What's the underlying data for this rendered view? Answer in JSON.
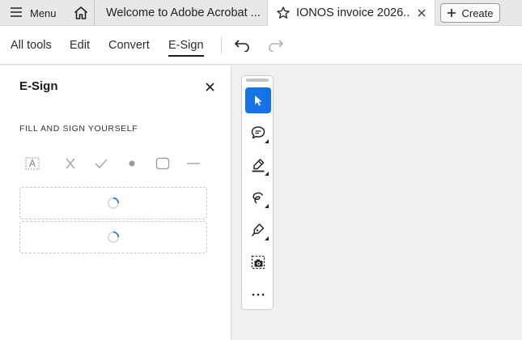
{
  "tabs": {
    "menu_label": "Menu",
    "welcome_title": "Welcome to Adobe Acrobat ...",
    "invoice_title": "IONOS invoice 2026...",
    "create_label": "Create"
  },
  "toolbar": {
    "items": [
      "All tools",
      "Edit",
      "Convert",
      "E-Sign"
    ],
    "active": "E-Sign"
  },
  "panel": {
    "title": "E-Sign",
    "section_label": "FILL AND SIGN YOURSELF",
    "sign_tools": [
      "text-field-icon",
      "cross-icon",
      "checkmark-icon",
      "dot-icon",
      "rounded-rect-icon",
      "line-icon"
    ]
  },
  "quick_actions": [
    "select-pointer-icon",
    "comment-icon",
    "highlight-icon",
    "freehand-draw-icon",
    "sign-pen-icon",
    "snapshot-icon",
    "more-icon"
  ],
  "colors": {
    "accent": "#1473e6"
  }
}
